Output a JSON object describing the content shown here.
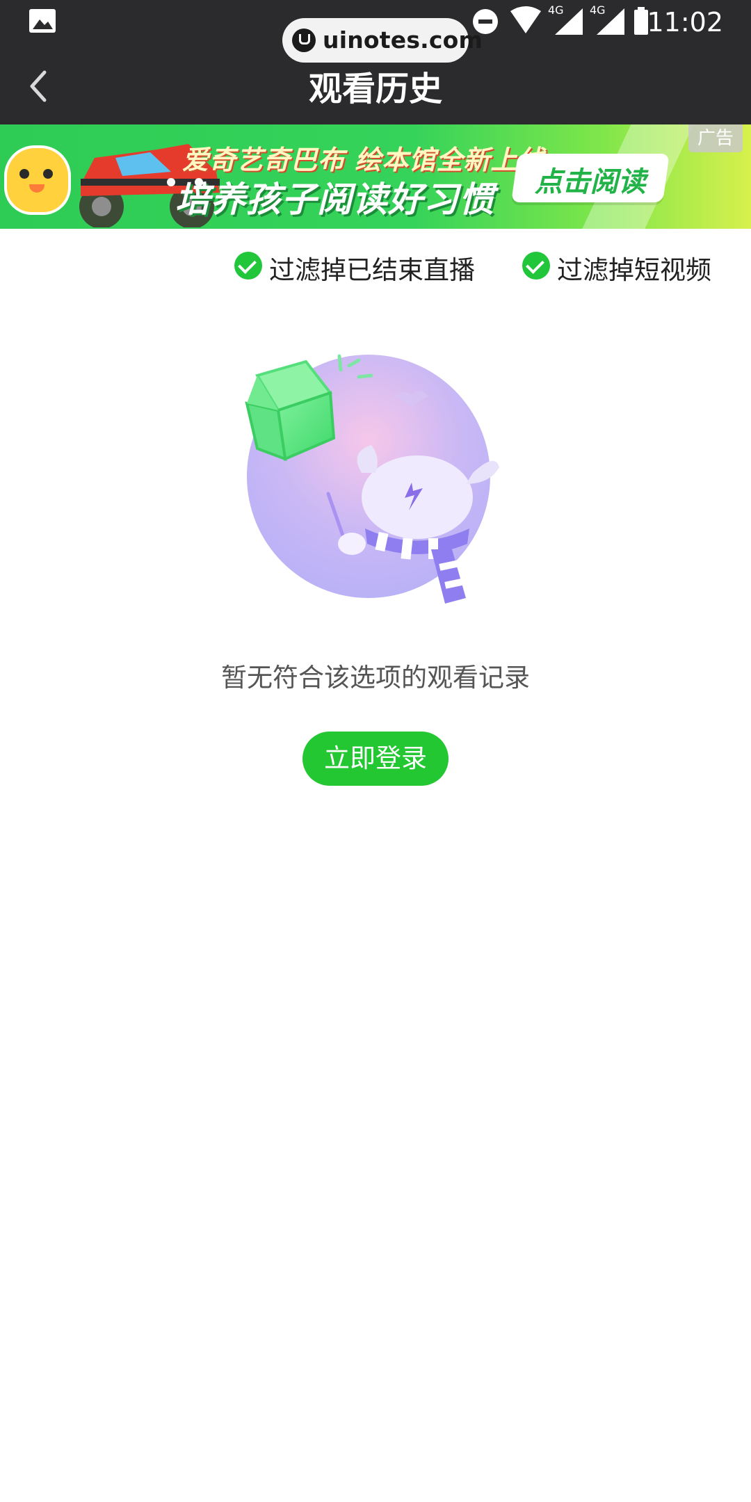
{
  "status_bar": {
    "time": "11:02",
    "watermark": "uinotes.com",
    "network_labels": [
      "4G",
      "4G"
    ],
    "icons": [
      "image-icon",
      "dnd-icon",
      "wifi-icon",
      "signal-icon",
      "signal-icon",
      "battery-icon"
    ]
  },
  "nav": {
    "back_icon": "chevron-left-icon",
    "title": "观看历史"
  },
  "ad": {
    "line1": "爱奇艺奇巴布 绘本馆全新上线",
    "line2": "培养孩子阅读好习惯",
    "cta": "点击阅读",
    "tag": "广告"
  },
  "filters": [
    {
      "label": "过滤掉已结束直播",
      "checked": true
    },
    {
      "label": "过滤掉短视频",
      "checked": true
    }
  ],
  "empty_state": {
    "message": "暂无符合该选项的观看记录",
    "button": "立即登录"
  },
  "colors": {
    "header_bg": "#2b2b2d",
    "accent_green": "#22c731",
    "check_green": "#22c63a"
  }
}
